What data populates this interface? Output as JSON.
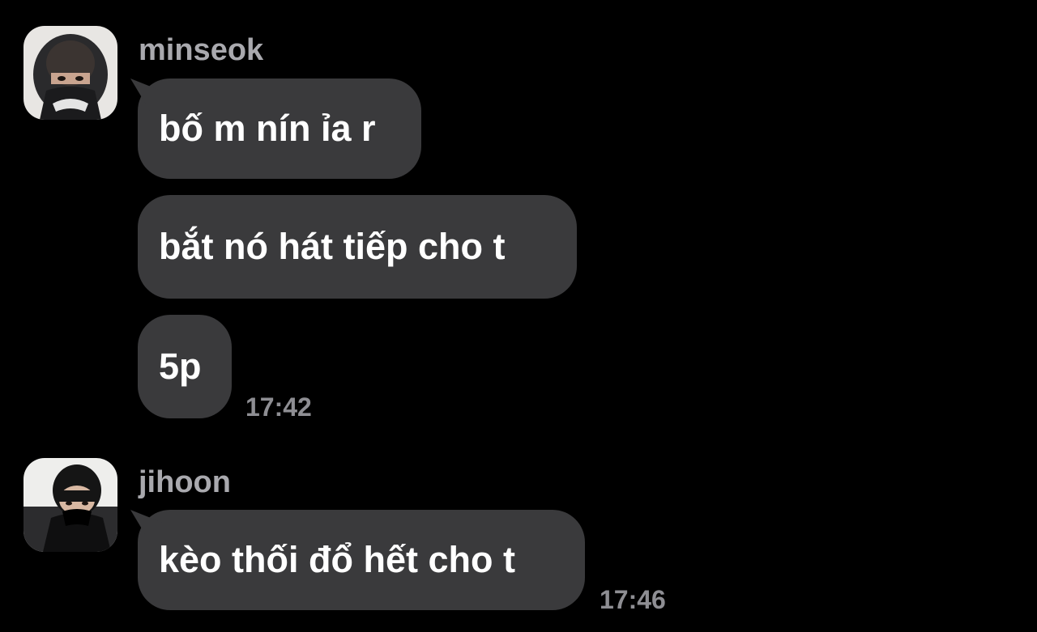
{
  "chat": {
    "groups": [
      {
        "sender": "minseok",
        "messages": [
          "bố m nín ỉa r",
          "bắt nó hát tiếp cho t",
          "5p"
        ],
        "time": "17:42"
      },
      {
        "sender": "jihoon",
        "messages": [
          "kèo thối đổ hết cho t"
        ],
        "time": "17:46"
      }
    ]
  },
  "colors": {
    "background": "#000000",
    "bubble": "#3a3a3c",
    "sender_name": "#a9a9ae",
    "timestamp": "#8e8e93"
  },
  "icons": {
    "avatar_1": "user-avatar-photo",
    "avatar_2": "user-avatar-photo"
  }
}
